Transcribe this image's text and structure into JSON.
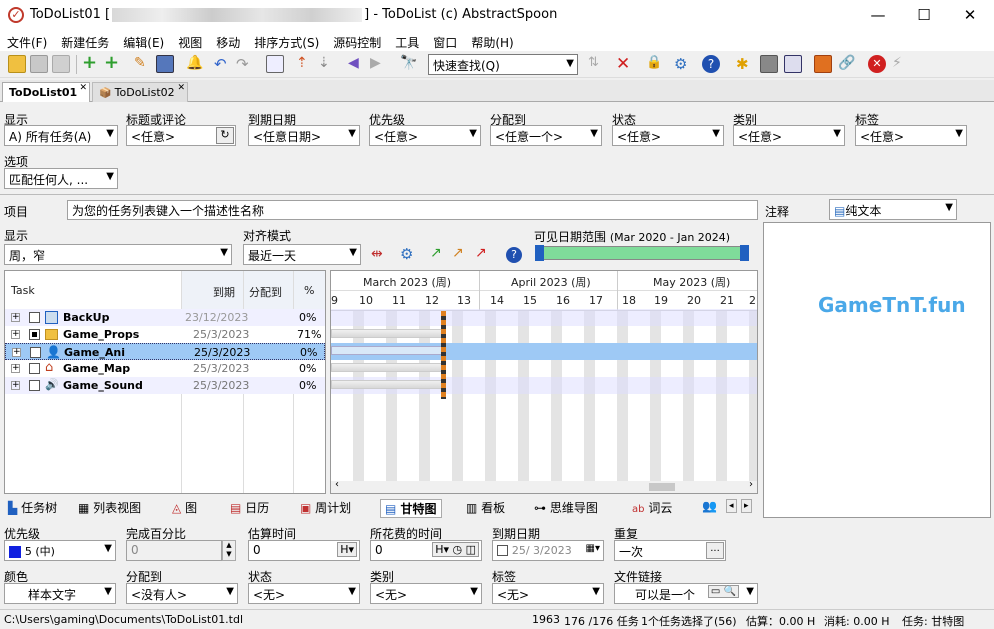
{
  "window": {
    "title_prefix": "ToDoList01 [",
    "title_suffix": "] - ToDoList (c) AbstractSpoon"
  },
  "menu": [
    "文件(F)",
    "新建任务",
    "编辑(E)",
    "视图",
    "移动",
    "排序方式(S)",
    "源码控制",
    "工具",
    "窗口",
    "帮助(H)"
  ],
  "toolbar": {
    "quickfind": "快速查找(Q)"
  },
  "tabs": [
    "ToDoList01",
    "ToDoList02"
  ],
  "filters": {
    "show_label": "显示",
    "show_value": "A)  所有任务(A)",
    "title_label": "标题或评论",
    "title_value": "<任意>",
    "due_label": "到期日期",
    "due_value": "<任意日期>",
    "priority_label": "优先级",
    "priority_value": "<任意>",
    "assigned_label": "分配到",
    "assigned_value": "<任意一个>",
    "status_label": "状态",
    "status_value": "<任意>",
    "category_label": "类别",
    "category_value": "<任意>",
    "tags_label": "标签",
    "tags_value": "<任意>",
    "options_label": "选项",
    "options_value": "匹配任何人, ..."
  },
  "project": {
    "label": "项目",
    "value": "为您的任务列表键入一个描述性名称"
  },
  "gantt_ctrl": {
    "display_label": "显示",
    "display_value": "周，窄",
    "snap_label": "对齐模式",
    "snap_value": "最近一天",
    "range_label": "可见日期范围",
    "range_value": "(Mar 2020 - Jan 2024)"
  },
  "notes": {
    "label": "注释",
    "format": "纯文本",
    "watermark": "GameTnT.fun"
  },
  "tree": {
    "headers": {
      "task": "Task",
      "due": "到期",
      "assigned": "分配到",
      "percent": "%"
    },
    "rows": [
      {
        "name": "BackUp",
        "due": "23/12/2023",
        "pct": "0%"
      },
      {
        "name": "Game_Props",
        "due": "25/3/2023",
        "pct": "71%"
      },
      {
        "name": "Game_Ani",
        "due": "25/3/2023",
        "pct": "0%"
      },
      {
        "name": "Game_Map",
        "due": "25/3/2023",
        "pct": "0%"
      },
      {
        "name": "Game_Sound",
        "due": "25/3/2023",
        "pct": "0%"
      }
    ]
  },
  "gantt": {
    "months": [
      "March 2023 (周)",
      "April 2023 (周)",
      "May 2023 (周)"
    ],
    "days": [
      "9",
      "10",
      "11",
      "12",
      "13",
      "14",
      "15",
      "16",
      "17",
      "18",
      "19",
      "20",
      "21",
      "2"
    ]
  },
  "views": [
    "任务树",
    "列表视图",
    "图",
    "日历",
    "周计划",
    "甘特图",
    "看板",
    "思维导图",
    "词云"
  ],
  "props": {
    "priority_label": "优先级",
    "priority_value": "5 (中)",
    "percent_label": "完成百分比",
    "percent_value": "0",
    "estimate_label": "估算时间",
    "estimate_value": "0",
    "estimate_unit": "H",
    "spent_label": "所花费的时间",
    "spent_value": "0",
    "spent_unit": "H",
    "due_label": "到期日期",
    "due_value": "25/  3/2023",
    "recur_label": "重复",
    "recur_value": "一次",
    "color_label": "颜色",
    "color_value": "样本文字",
    "assigned_label": "分配到",
    "assigned_value": "<没有人>",
    "status_label": "状态",
    "status_value": "<无>",
    "category_label": "类别",
    "category_value": "<无>",
    "tags_label": "标签",
    "tags_value": "<无>",
    "link_label": "文件链接",
    "link_value": "可以是一个"
  },
  "statusbar": {
    "path": "C:\\Users\\gaming\\Documents\\ToDoList01.tdl",
    "id": "1963",
    "count": "176 /176 任务",
    "selected": "1个任务选择了(56)",
    "estimate": "估算：0.00 H",
    "spent": "消耗: 0.00 H",
    "view": "任务: 甘特图"
  }
}
